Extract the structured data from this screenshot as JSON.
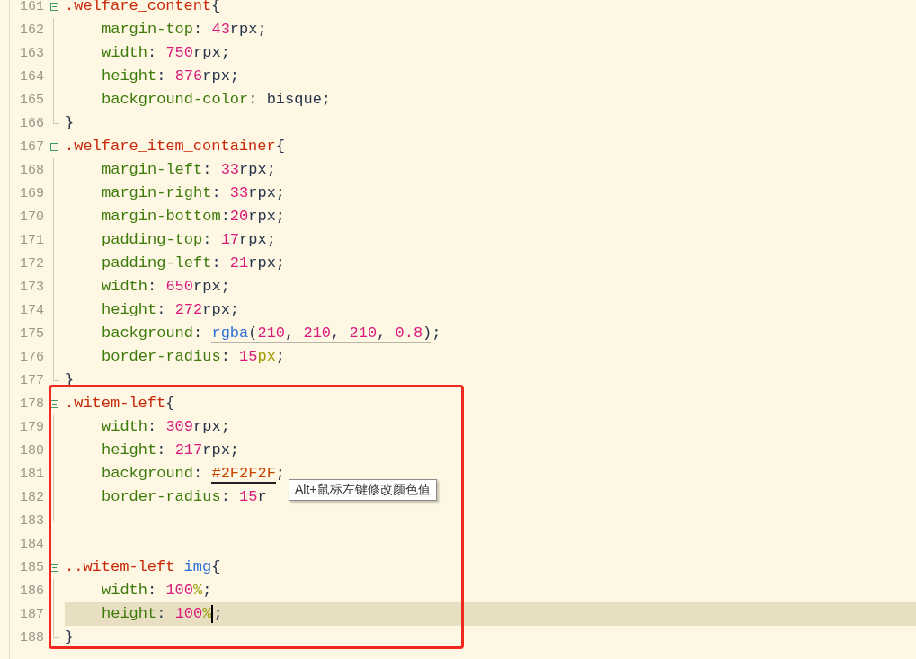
{
  "editor": {
    "lines": [
      {
        "number": "161",
        "kind": "opener",
        "current": false,
        "tokens": [
          {
            "kind": "selector",
            "text": ".welfare_content"
          },
          {
            "kind": "plain",
            "text": "{"
          }
        ]
      },
      {
        "number": "162",
        "kind": "body",
        "current": false,
        "tokens": [
          {
            "kind": "property",
            "text": "margin-top"
          },
          {
            "kind": "plain",
            "text": ": "
          },
          {
            "kind": "number",
            "text": "43"
          },
          {
            "kind": "plain",
            "text": "rpx;"
          }
        ]
      },
      {
        "number": "163",
        "kind": "body",
        "current": false,
        "tokens": [
          {
            "kind": "property",
            "text": "width"
          },
          {
            "kind": "plain",
            "text": ": "
          },
          {
            "kind": "number",
            "text": "750"
          },
          {
            "kind": "plain",
            "text": "rpx;"
          }
        ]
      },
      {
        "number": "164",
        "kind": "body",
        "current": false,
        "tokens": [
          {
            "kind": "property",
            "text": "height"
          },
          {
            "kind": "plain",
            "text": ": "
          },
          {
            "kind": "number",
            "text": "876"
          },
          {
            "kind": "plain",
            "text": "rpx;"
          }
        ]
      },
      {
        "number": "165",
        "kind": "body",
        "current": false,
        "tokens": [
          {
            "kind": "property",
            "text": "background-color"
          },
          {
            "kind": "plain",
            "text": ": bisque;"
          }
        ]
      },
      {
        "number": "166",
        "kind": "closer",
        "current": false,
        "tokens": [
          {
            "kind": "plain",
            "text": "}"
          }
        ]
      },
      {
        "number": "167",
        "kind": "opener",
        "current": false,
        "tokens": [
          {
            "kind": "selector",
            "text": ".welfare_item_container"
          },
          {
            "kind": "plain",
            "text": "{"
          }
        ]
      },
      {
        "number": "168",
        "kind": "body",
        "current": false,
        "tokens": [
          {
            "kind": "property",
            "text": "margin-left"
          },
          {
            "kind": "plain",
            "text": ": "
          },
          {
            "kind": "number",
            "text": "33"
          },
          {
            "kind": "plain",
            "text": "rpx;"
          }
        ]
      },
      {
        "number": "169",
        "kind": "body",
        "current": false,
        "tokens": [
          {
            "kind": "property",
            "text": "margin-right"
          },
          {
            "kind": "plain",
            "text": ": "
          },
          {
            "kind": "number",
            "text": "33"
          },
          {
            "kind": "plain",
            "text": "rpx;"
          }
        ]
      },
      {
        "number": "170",
        "kind": "body",
        "current": false,
        "tokens": [
          {
            "kind": "property",
            "text": "margin-bottom"
          },
          {
            "kind": "plain",
            "text": ":"
          },
          {
            "kind": "number",
            "text": "20"
          },
          {
            "kind": "plain",
            "text": "rpx;"
          }
        ]
      },
      {
        "number": "171",
        "kind": "body",
        "current": false,
        "tokens": [
          {
            "kind": "property",
            "text": "padding-top"
          },
          {
            "kind": "plain",
            "text": ": "
          },
          {
            "kind": "number",
            "text": "17"
          },
          {
            "kind": "plain",
            "text": "rpx;"
          }
        ]
      },
      {
        "number": "172",
        "kind": "body",
        "current": false,
        "tokens": [
          {
            "kind": "property",
            "text": "padding-left"
          },
          {
            "kind": "plain",
            "text": ": "
          },
          {
            "kind": "number",
            "text": "21"
          },
          {
            "kind": "plain",
            "text": "rpx;"
          }
        ]
      },
      {
        "number": "173",
        "kind": "body",
        "current": false,
        "tokens": [
          {
            "kind": "property",
            "text": "width"
          },
          {
            "kind": "plain",
            "text": ": "
          },
          {
            "kind": "number",
            "text": "650"
          },
          {
            "kind": "plain",
            "text": "rpx;"
          }
        ]
      },
      {
        "number": "174",
        "kind": "body",
        "current": false,
        "tokens": [
          {
            "kind": "property",
            "text": "height"
          },
          {
            "kind": "plain",
            "text": ": "
          },
          {
            "kind": "number",
            "text": "272"
          },
          {
            "kind": "plain",
            "text": "rpx;"
          }
        ]
      },
      {
        "number": "175",
        "kind": "body",
        "current": false,
        "tokens": [
          {
            "kind": "property",
            "text": "background"
          },
          {
            "kind": "plain",
            "text": ": "
          },
          {
            "kind": "function",
            "text": "rgba",
            "underlined": true
          },
          {
            "kind": "plain",
            "text": "(",
            "underlined": true
          },
          {
            "kind": "number",
            "text": "210",
            "underlined": true
          },
          {
            "kind": "plain",
            "text": ", ",
            "underlined": true
          },
          {
            "kind": "number",
            "text": "210",
            "underlined": true
          },
          {
            "kind": "plain",
            "text": ", ",
            "underlined": true
          },
          {
            "kind": "number",
            "text": "210",
            "underlined": true
          },
          {
            "kind": "plain",
            "text": ", ",
            "underlined": true
          },
          {
            "kind": "number",
            "text": "0.8",
            "underlined": true
          },
          {
            "kind": "plain",
            "text": ")",
            "underlined": true
          },
          {
            "kind": "plain",
            "text": ";"
          }
        ]
      },
      {
        "number": "176",
        "kind": "body",
        "current": false,
        "tokens": [
          {
            "kind": "property",
            "text": "border-radius"
          },
          {
            "kind": "plain",
            "text": ": "
          },
          {
            "kind": "number",
            "text": "15"
          },
          {
            "kind": "unit",
            "text": "px"
          },
          {
            "kind": "plain",
            "text": ";"
          }
        ]
      },
      {
        "number": "177",
        "kind": "closer",
        "current": false,
        "tokens": [
          {
            "kind": "plain",
            "text": "}"
          }
        ]
      },
      {
        "number": "178",
        "kind": "opener",
        "current": false,
        "tokens": [
          {
            "kind": "selector",
            "text": ".witem-left"
          },
          {
            "kind": "plain",
            "text": "{"
          }
        ]
      },
      {
        "number": "179",
        "kind": "body",
        "current": false,
        "tokens": [
          {
            "kind": "property",
            "text": "width"
          },
          {
            "kind": "plain",
            "text": ": "
          },
          {
            "kind": "number",
            "text": "309"
          },
          {
            "kind": "plain",
            "text": "rpx;"
          }
        ]
      },
      {
        "number": "180",
        "kind": "body",
        "current": false,
        "tokens": [
          {
            "kind": "property",
            "text": "height"
          },
          {
            "kind": "plain",
            "text": ": "
          },
          {
            "kind": "number",
            "text": "217"
          },
          {
            "kind": "plain",
            "text": "rpx;"
          }
        ]
      },
      {
        "number": "181",
        "kind": "body",
        "current": false,
        "tokens": [
          {
            "kind": "property",
            "text": "background"
          },
          {
            "kind": "plain",
            "text": ": "
          },
          {
            "kind": "hex",
            "text": "#2F2F2F",
            "underlined": true
          },
          {
            "kind": "plain",
            "text": ";"
          }
        ]
      },
      {
        "number": "182",
        "kind": "body",
        "current": false,
        "tokens": [
          {
            "kind": "property",
            "text": "border-radius"
          },
          {
            "kind": "plain",
            "text": ": "
          },
          {
            "kind": "number",
            "text": "15"
          },
          {
            "kind": "plain",
            "text": "r"
          }
        ]
      },
      {
        "number": "183",
        "kind": "closer",
        "current": false
      },
      {
        "number": "184",
        "kind": "blank",
        "current": false
      },
      {
        "number": "185",
        "kind": "opener",
        "current": false,
        "tokens": [
          {
            "kind": "selector",
            "text": "..witem-left"
          },
          {
            "kind": "tag",
            "text": "img"
          },
          {
            "kind": "plain",
            "text": "{"
          }
        ]
      },
      {
        "number": "186",
        "kind": "body",
        "current": false,
        "tokens": [
          {
            "kind": "property",
            "text": "width"
          },
          {
            "kind": "plain",
            "text": ": "
          },
          {
            "kind": "number",
            "text": "100"
          },
          {
            "kind": "unit",
            "text": "%"
          },
          {
            "kind": "plain",
            "text": ";"
          }
        ]
      },
      {
        "number": "187",
        "kind": "body",
        "current": true,
        "tokens": [
          {
            "kind": "property",
            "text": "height"
          },
          {
            "kind": "plain",
            "text": ": "
          },
          {
            "kind": "number",
            "text": "100"
          },
          {
            "kind": "unit",
            "text": "%",
            "caret": true
          },
          {
            "kind": "plain",
            "text": ";"
          }
        ]
      },
      {
        "number": "188",
        "kind": "closer",
        "current": false,
        "tokens": [
          {
            "kind": "plain",
            "text": "}"
          }
        ]
      }
    ]
  },
  "tooltip": {
    "text": "Alt+鼠标左键修改颜色值"
  }
}
